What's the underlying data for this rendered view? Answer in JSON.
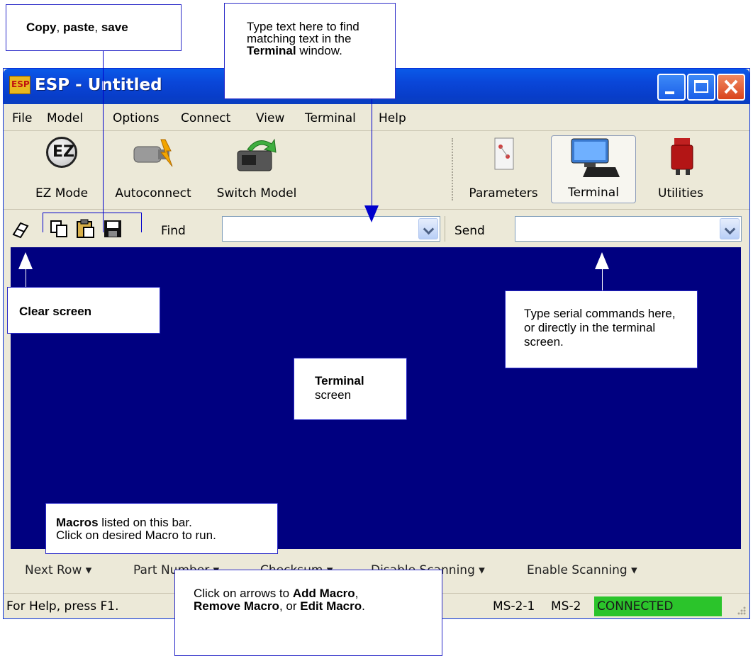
{
  "window": {
    "title": "ESP - Untitled",
    "logo_text": "ESP"
  },
  "menu": [
    "File",
    "Model",
    "Options",
    "Connect",
    "View",
    "Terminal",
    "Help"
  ],
  "toolbar": {
    "ez_mode": "EZ Mode",
    "ez_icon_text": "EZ",
    "autoconnect": "Autoconnect",
    "switch_model": "Switch Model",
    "parameters": "Parameters",
    "terminal": "Terminal",
    "utilities": "Utilities"
  },
  "findbar": {
    "find_label": "Find",
    "send_label": "Send"
  },
  "macros": [
    "Next Row",
    "Part Number",
    "Checksum",
    "Disable Scanning",
    "Enable Scanning"
  ],
  "status": {
    "help": "For Help, press F1.",
    "port1": "MS-2-1",
    "port2": "MS-2",
    "connection": "CONNECTED"
  },
  "callouts": {
    "copy_paste_save": {
      "b1": "Copy",
      "t1": ", ",
      "b2": "paste",
      "t2": ", ",
      "b3": "save"
    },
    "find": {
      "t1": "Type text here to find matching text in the ",
      "b1": "Terminal",
      "t2": " window."
    },
    "clear": {
      "b1": "Clear screen"
    },
    "send": {
      "t1": "Type serial commands here, or directly in the terminal screen."
    },
    "terminal": {
      "b1": "Terminal",
      "t1": "screen"
    },
    "macros": {
      "b1": "Macros",
      "t1": " listed on this bar.",
      "t2": "Click on desired Macro to run."
    },
    "arrows": {
      "t1": "Click on arrows to ",
      "b1": "Add Macro",
      "t2": ",",
      "b2": "Remove Macro",
      "t3": ", or ",
      "b3": "Edit Macro",
      "t4": "."
    }
  },
  "colors": {
    "terminal_bg": "#000080",
    "connected_bg": "#2bc42b",
    "titlebar": "#0a46d8"
  }
}
